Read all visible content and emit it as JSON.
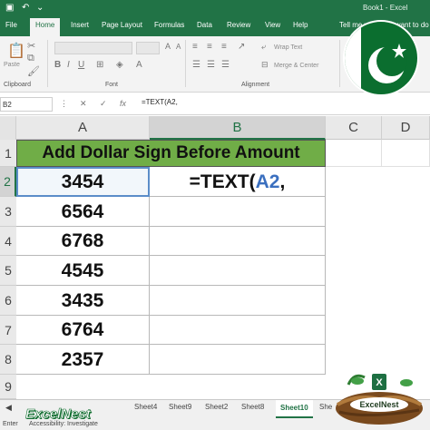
{
  "window": {
    "title": "Book1 - Excel",
    "undo_icon": "undo-icon",
    "quick_access_icon": "save-icon"
  },
  "ribbon_tabs": [
    {
      "label": "File"
    },
    {
      "label": "Home"
    },
    {
      "label": "Insert"
    },
    {
      "label": "Page Layout"
    },
    {
      "label": "Formulas"
    },
    {
      "label": "Data"
    },
    {
      "label": "Review"
    },
    {
      "label": "View"
    },
    {
      "label": "Help"
    },
    {
      "label": "Tell me what you want to do"
    }
  ],
  "ribbon": {
    "paste_label": "Paste",
    "clipboard_label": "Clipboard",
    "font_label": "Font",
    "alignment_label": "Alignment",
    "wrap_text_label": "Wrap Text",
    "merge_label": "Merge & Center"
  },
  "formula_bar": {
    "name_box": "B2",
    "cancel_icon": "close-icon",
    "enter_icon": "checkmark-icon",
    "fx_label": "fx",
    "formula": "=TEXT(A2,"
  },
  "columns": [
    "A",
    "B",
    "C",
    "D"
  ],
  "rows": [
    "1",
    "2",
    "3",
    "4",
    "5",
    "6",
    "7",
    "8",
    "9"
  ],
  "sheet": {
    "header": "Add Dollar Sign Before Amount",
    "values": [
      "3454",
      "6564",
      "6768",
      "4545",
      "3435",
      "6764",
      "2357"
    ],
    "edit_formula_prefix": "=TEXT(",
    "edit_formula_ref": "A2",
    "edit_formula_suffix": ","
  },
  "sheet_tabs": [
    {
      "label": "Sheet4"
    },
    {
      "label": "Sheet9"
    },
    {
      "label": "Sheet2"
    },
    {
      "label": "Sheet8"
    },
    {
      "label": "Sheet10",
      "active": true
    },
    {
      "label": "She"
    }
  ],
  "status": {
    "mode": "Enter",
    "accessibility": "Accessibility: Investigate"
  },
  "brand": {
    "name": "ExcelNest",
    "logo_text": "ExcelNest"
  },
  "colors": {
    "excel_green": "#217346",
    "header_fill": "#70ad47",
    "reference_blue": "#3a6fbf"
  }
}
